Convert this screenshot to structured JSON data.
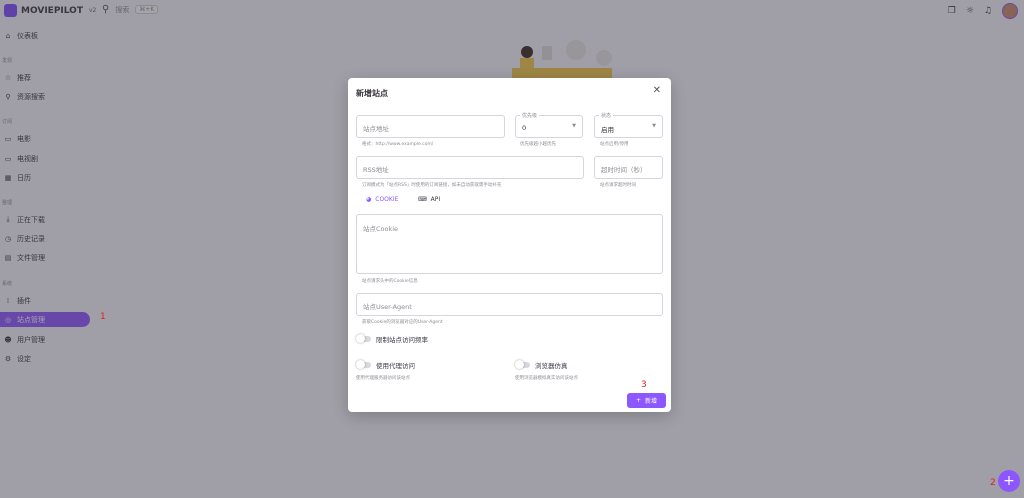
{
  "app": {
    "name": "MOVIEPILOT",
    "version": "v2"
  },
  "search": {
    "placeholder": "搜索",
    "shortcut": "K"
  },
  "nav": {
    "dashboard": "仪表板",
    "section_discover": "发现",
    "recommend": "推荐",
    "resource_search": "资源搜索",
    "section_subscribe": "订阅",
    "movie": "电影",
    "tv": "电视剧",
    "calendar": "日历",
    "section_organize": "整理",
    "downloading": "正在下载",
    "history": "历史记录",
    "file_manager": "文件管理",
    "section_system": "系统",
    "plugins": "插件",
    "site_manage": "站点管理",
    "user_manage": "用户管理",
    "settings": "设定"
  },
  "annotations": {
    "one": "1",
    "two": "2",
    "three": "3"
  },
  "dialog": {
    "title": "新增站点",
    "site_url_placeholder": "站点地址",
    "site_url_hint": "格式：http://www.example.com/",
    "priority_label": "优先级",
    "priority_value": "0",
    "priority_hint": "优先级越小越优先",
    "status_label": "状态",
    "status_value": "启用",
    "status_hint": "站点启用/停用",
    "rss_placeholder": "RSS地址",
    "rss_hint": "订阅模式为「站点RSS」时使用的订阅链接，如未自动获取需手动补充",
    "timeout_placeholder": "超时时间（秒）",
    "timeout_hint": "站点请求超时时间",
    "tab_cookie": "COOKIE",
    "tab_api": "API",
    "cookie_placeholder": "站点Cookie",
    "cookie_hint": "站点请求头中的Cookie信息",
    "ua_placeholder": "站点User-Agent",
    "ua_hint": "获取Cookie的浏览器对应的User-Agent",
    "limit_label": "限制站点访问频率",
    "proxy_label": "使用代理访问",
    "proxy_hint": "使用代理服务器访问该站点",
    "browser_label": "浏览器仿真",
    "browser_hint": "使用浏览器模拟真实访问该站点",
    "add_button": "新增"
  }
}
